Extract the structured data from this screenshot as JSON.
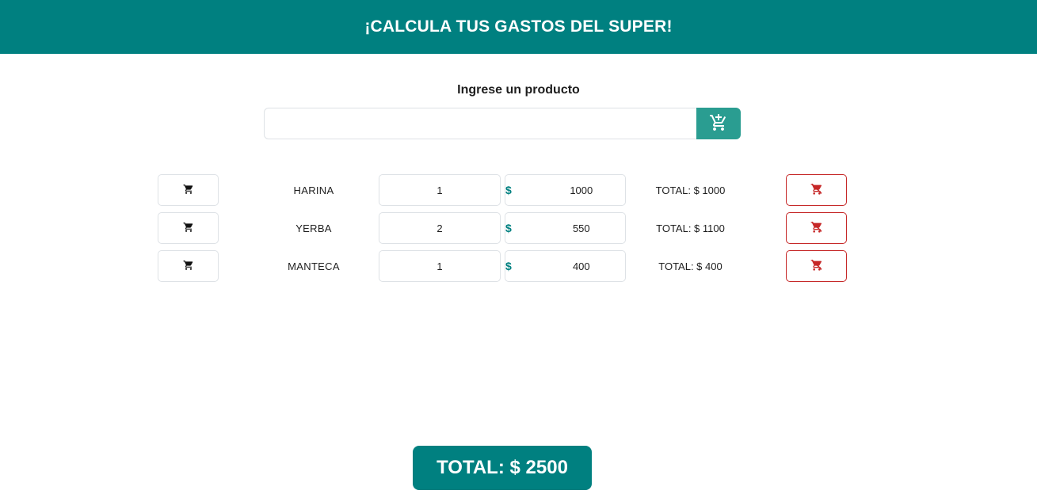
{
  "header": {
    "title": "¡CALCULA TUS GASTOS DEL SUPER!"
  },
  "form": {
    "label": "Ingrese un producto",
    "input_value": "",
    "input_placeholder": "",
    "add_icon": "cart-plus-icon"
  },
  "currency_symbol": "$",
  "icons": {
    "row_cart": "cart-icon",
    "row_remove": "cart-remove-icon"
  },
  "items": [
    {
      "name": "HARINA",
      "quantity": "1",
      "price": "1000",
      "subtotal_label": "TOTAL: $ 1000"
    },
    {
      "name": "YERBA",
      "quantity": "2",
      "price": "550",
      "subtotal_label": "TOTAL: $ 1100"
    },
    {
      "name": "MANTECA",
      "quantity": "1",
      "price": "400",
      "subtotal_label": "TOTAL: $ 400"
    }
  ],
  "grand_total": {
    "label": "TOTAL: $ 2500"
  },
  "colors": {
    "primary": "#008080",
    "add_button": "#2a9d91",
    "remove": "#c62828"
  }
}
